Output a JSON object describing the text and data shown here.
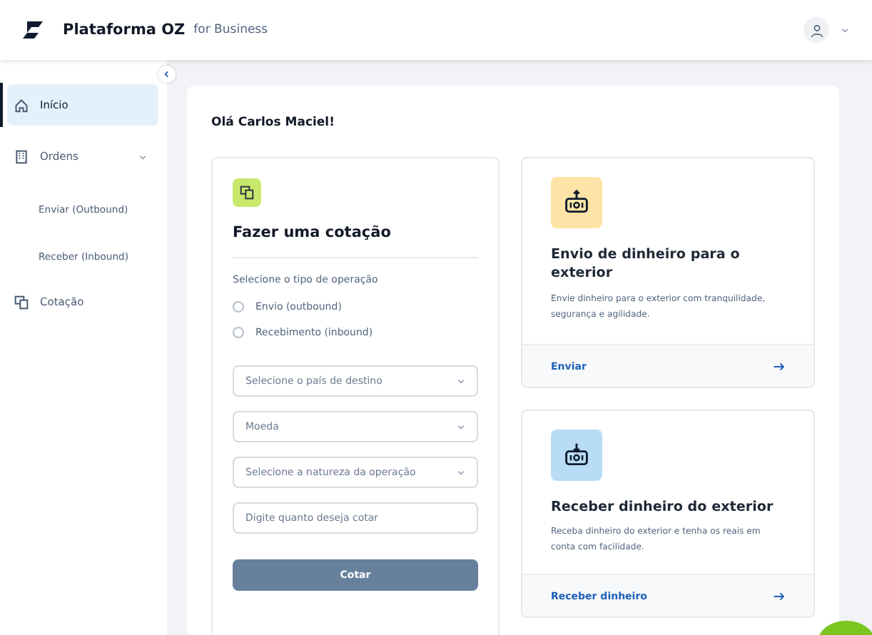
{
  "header": {
    "brand": "Plataforma OZ",
    "tagline": "for Business"
  },
  "sidebar": {
    "items": [
      {
        "label": "Início",
        "kind": "home",
        "selected": true
      },
      {
        "label": "Ordens",
        "kind": "orders",
        "selected": false,
        "expanded": true,
        "children": [
          {
            "label": "Enviar (Outbound)",
            "selected": false
          },
          {
            "label": "Receber (Inbound)",
            "selected": false
          }
        ]
      },
      {
        "label": "Cotação",
        "kind": "quote",
        "selected": false
      }
    ]
  },
  "greeting": "Olá Carlos Maciel!",
  "quote_form": {
    "title": "Fazer uma cotação",
    "operation_label": "Selecione o tipo de operação",
    "options": [
      {
        "label": "Envio (outbound)",
        "selected": false
      },
      {
        "label": "Recebimento (inbound)",
        "selected": false
      }
    ],
    "fields": [
      {
        "kind": "select",
        "placeholder": "Selecione o país de destino"
      },
      {
        "kind": "select",
        "placeholder": "Moeda"
      },
      {
        "kind": "select",
        "placeholder": "Selecione a natureza da operação"
      },
      {
        "kind": "input",
        "placeholder": "Digite quanto deseja cotar"
      }
    ],
    "submit": "Cotar"
  },
  "cards": [
    {
      "kind": "send",
      "title": "Envio de dinheiro para o exterior",
      "description": "Envie dinheiro para o exterior com tranquilidade, segurança e agilidade.",
      "action": "Enviar"
    },
    {
      "kind": "receive",
      "title": "Receber dinheiro do exterior",
      "description": "Receba dinheiro do exterior e tenha os reais em conta com facilidade.",
      "action": "Receber dinheiro"
    }
  ]
}
